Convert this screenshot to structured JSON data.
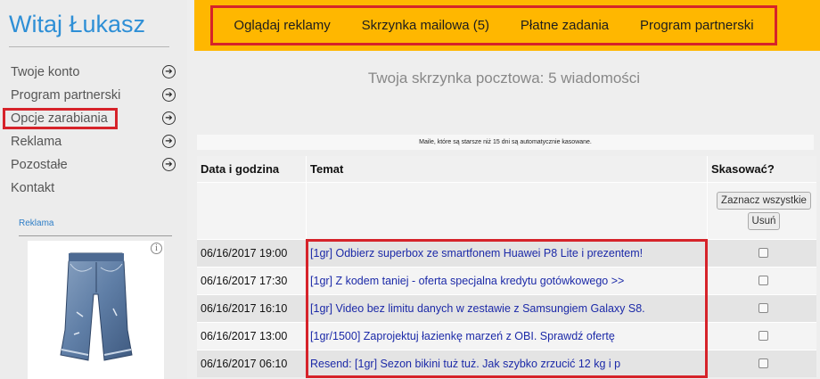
{
  "sidebar": {
    "greeting": "Witaj Łukasz",
    "items": [
      {
        "label": "Twoje konto",
        "has_arrow": true
      },
      {
        "label": "Program partnerski",
        "has_arrow": true
      },
      {
        "label": "Opcje zarabiania",
        "has_arrow": true
      },
      {
        "label": "Reklama",
        "has_arrow": true
      },
      {
        "label": "Pozostałe",
        "has_arrow": true
      },
      {
        "label": "Kontakt",
        "has_arrow": false
      }
    ],
    "ad_label": "Reklama",
    "ad_info": "i"
  },
  "topnav": {
    "items": [
      "Oglądaj reklamy",
      "Skrzynka mailowa (5)",
      "Płatne zadania",
      "Program partnerski"
    ]
  },
  "mailbox": {
    "title": "Twoja skrzynka pocztowa: 5 wiadomości",
    "notice": "Maile, które są starsze niż 15 dni są automatycznie kasowane.",
    "columns": [
      "Data i godzina",
      "Temat",
      "Skasować?"
    ],
    "select_all_label": "Zaznacz wszystkie",
    "delete_label": "Usuń",
    "rows": [
      {
        "date": "06/16/2017 19:00",
        "subject": "[1gr] Odbierz superbox ze smartfonem Huawei P8 Lite i prezentem!"
      },
      {
        "date": "06/16/2017 17:30",
        "subject": "[1gr] Z kodem taniej - oferta specjalna kredytu gotówkowego >>"
      },
      {
        "date": "06/16/2017 16:10",
        "subject": "[1gr] Video bez limitu danych w zestawie z Samsungiem Galaxy S8."
      },
      {
        "date": "06/16/2017 13:00",
        "subject": "[1gr/1500] Zaprojektuj łazienkę marzeń z OBI. Sprawdź ofertę"
      },
      {
        "date": "06/16/2017 06:10",
        "subject": "Resend: [1gr] Sezon bikini tuż tuż. Jak szybko zrzucić 12 kg i p"
      }
    ]
  },
  "colors": {
    "accent_blue": "#2e8fd6",
    "topbar_yellow": "#ffb700",
    "highlight_red": "#d6232a",
    "link_blue": "#1c2aa8"
  }
}
